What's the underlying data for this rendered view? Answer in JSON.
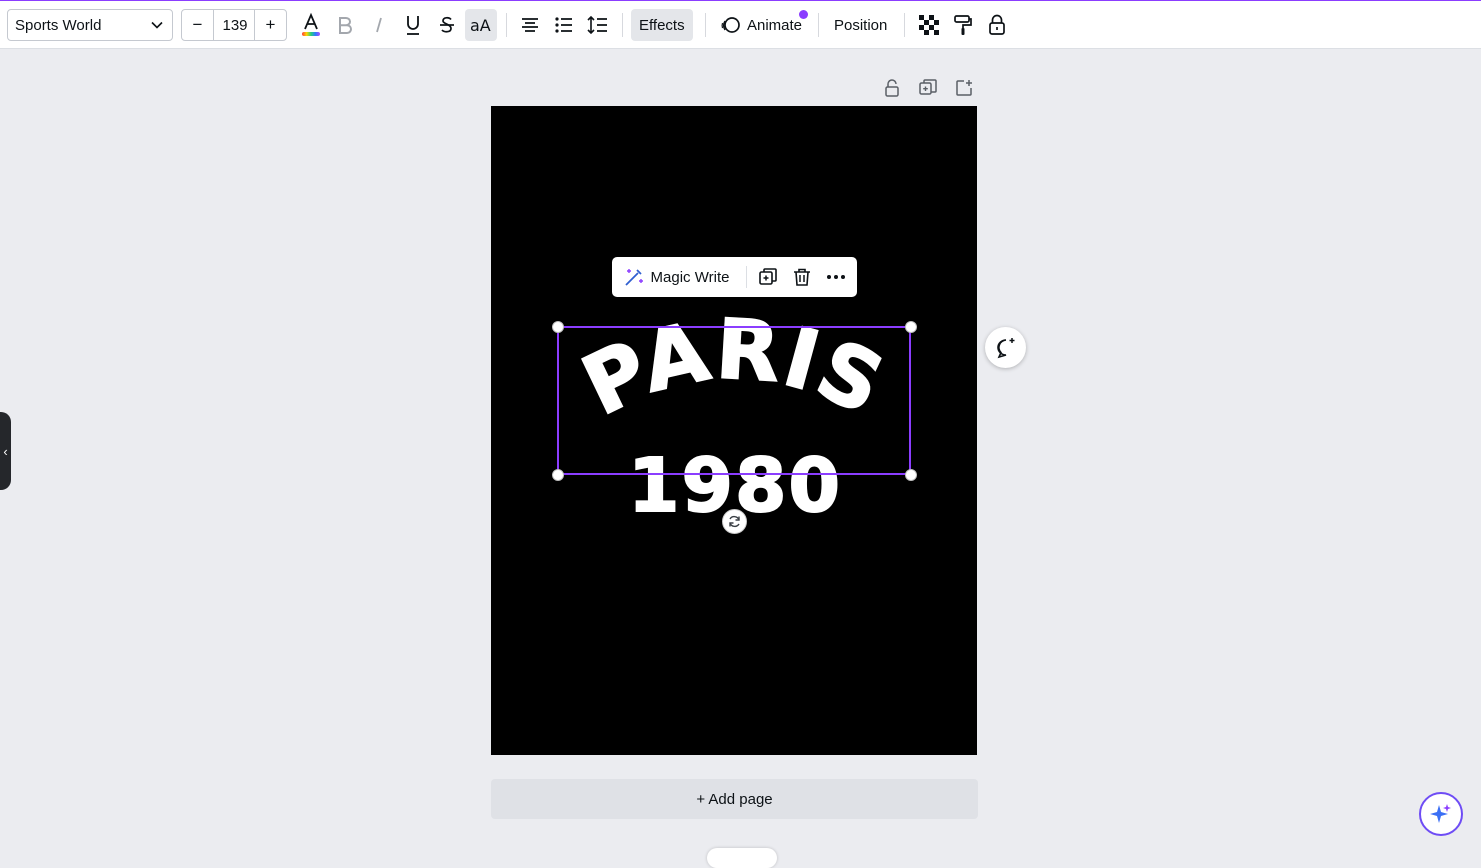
{
  "toolbar": {
    "font_name": "Sports World",
    "font_size": "139",
    "minus_label": "−",
    "plus_label": "+",
    "effects_label": "Effects",
    "animate_label": "Animate",
    "position_label": "Position",
    "text_color_gradient": [
      "#ff3b3b",
      "#ffd400",
      "#26d07c",
      "#2b7bff",
      "#b04cff"
    ]
  },
  "context_menu": {
    "magic_write_label": "Magic Write"
  },
  "design": {
    "background": "#000000",
    "title": "PARIS",
    "year": "1980",
    "text_color": "#ffffff"
  },
  "canvas": {
    "add_page_label": "+ Add page"
  },
  "colors": {
    "accent": "#8b3dff",
    "workspace": "#ebecf0"
  }
}
